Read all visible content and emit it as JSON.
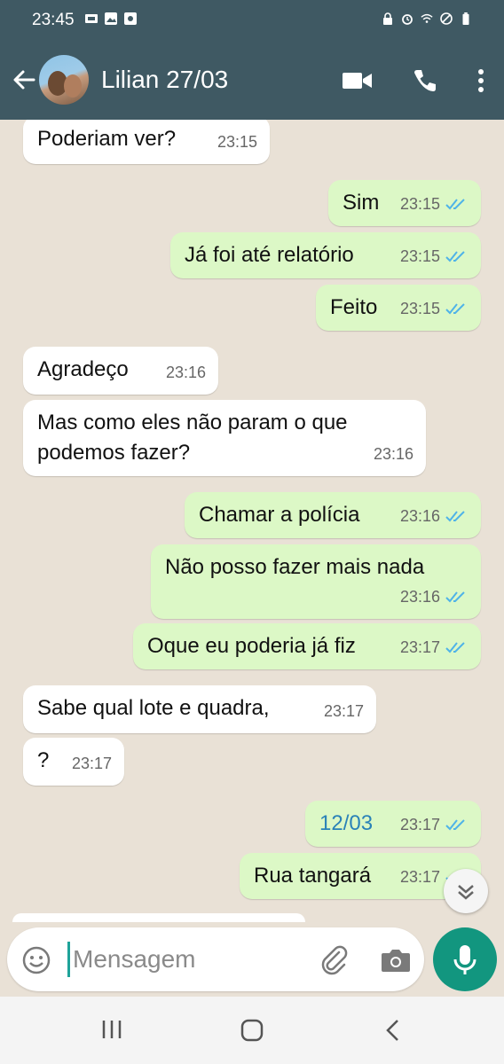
{
  "status_bar": {
    "time": "23:45",
    "left_icons": [
      "sim-icon",
      "gallery-icon",
      "camera-notification-icon"
    ],
    "right_icons": [
      "lock-icon",
      "alarm-icon",
      "wifi-icon",
      "do-not-disturb-icon",
      "battery-icon"
    ]
  },
  "header": {
    "contact_name": "Lilian 27/03",
    "icons": [
      "back-arrow-icon",
      "video-call-icon",
      "voice-call-icon",
      "more-options-icon"
    ]
  },
  "messages": [
    {
      "dir": "in",
      "text": "Poderiam ver?",
      "time": "23:15"
    },
    {
      "dir": "out",
      "text": "Sim",
      "time": "23:15",
      "status": "read"
    },
    {
      "dir": "out",
      "text": "Já foi até relatório",
      "time": "23:15",
      "status": "read"
    },
    {
      "dir": "out",
      "text": "Feito",
      "time": "23:15",
      "status": "read"
    },
    {
      "dir": "in",
      "text": "Agradeço",
      "time": "23:16"
    },
    {
      "dir": "in",
      "text": "Mas como eles não param o que podemos fazer?",
      "time": "23:16"
    },
    {
      "dir": "out",
      "text": "Chamar a polícia",
      "time": "23:16",
      "status": "read"
    },
    {
      "dir": "out",
      "text": "Não posso fazer mais nada",
      "time": "23:16",
      "status": "read"
    },
    {
      "dir": "out",
      "text": "Oque eu poderia já fiz",
      "time": "23:17",
      "status": "read"
    },
    {
      "dir": "in",
      "text": "Sabe qual lote e quadra,",
      "time": "23:17"
    },
    {
      "dir": "in",
      "text": "?",
      "time": "23:17"
    },
    {
      "dir": "out",
      "text": "12/03",
      "time": "23:17",
      "status": "read"
    },
    {
      "dir": "out",
      "text": "Rua tangará",
      "time": "23:17",
      "status": "read"
    }
  ],
  "composer": {
    "placeholder": "Mensagem",
    "value": ""
  },
  "colors": {
    "header": "#3f5963",
    "outgoing_bubble": "#dcf8c6",
    "incoming_bubble": "#ffffff",
    "chat_background": "#e9e1d6",
    "mic_button": "#12967f",
    "read_tick": "#4fb3e8"
  }
}
